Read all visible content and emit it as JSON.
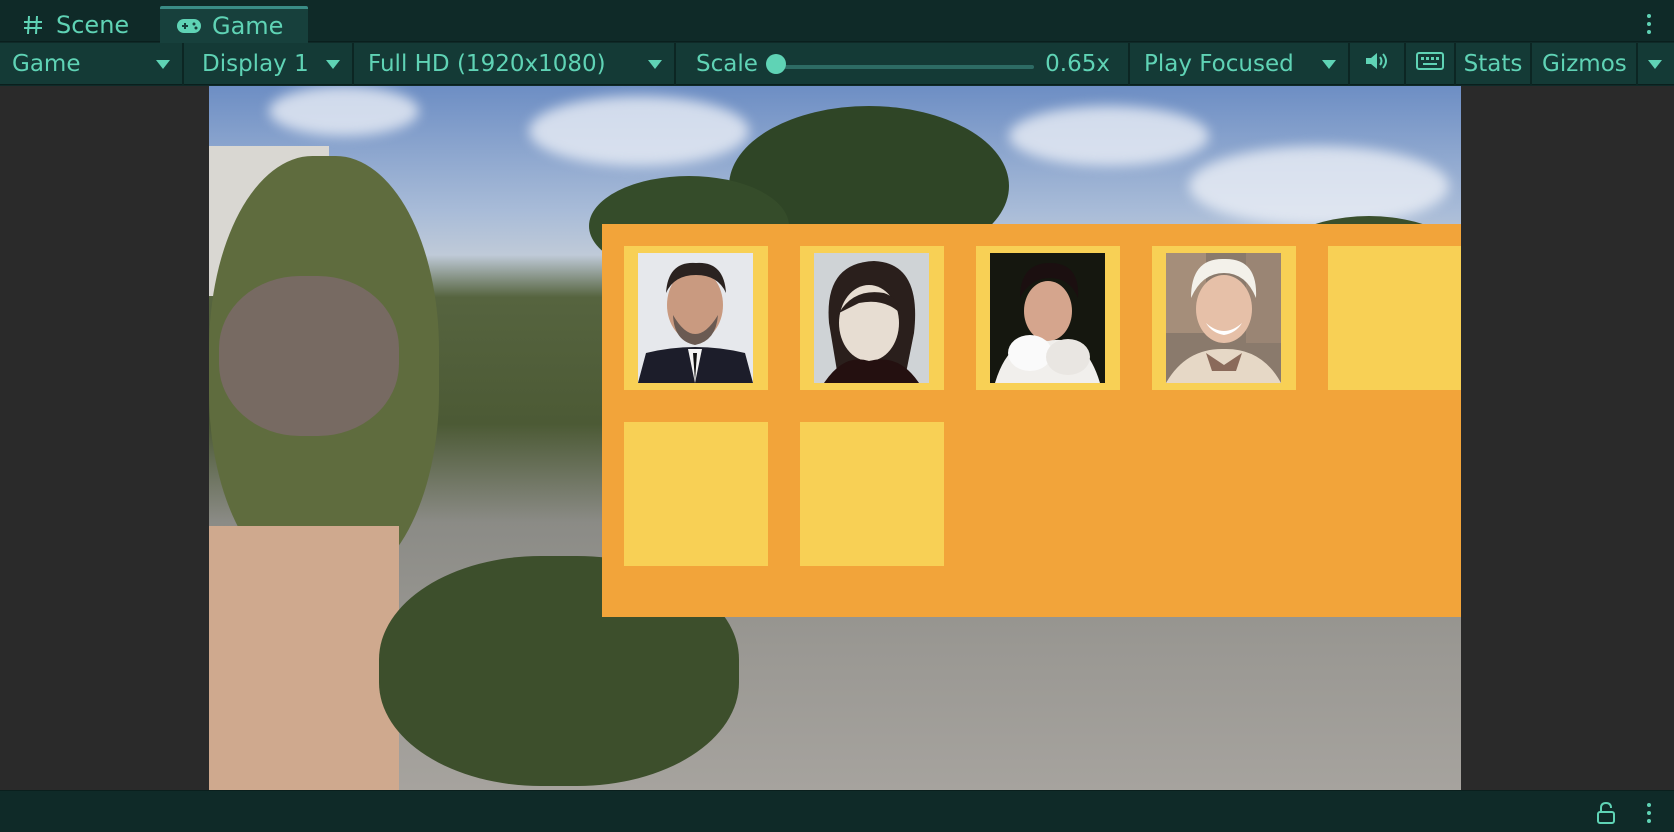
{
  "tabs": {
    "scene_label": "Scene",
    "game_label": "Game"
  },
  "toolbar": {
    "view_mode": "Game",
    "display": "Display 1",
    "resolution": "Full HD (1920x1080)",
    "scale_label": "Scale",
    "scale_value": "0.65x",
    "scale_slider_fraction": 0.0,
    "play_mode": "Play Focused",
    "stats_label": "Stats",
    "gizmos_label": "Gizmos"
  },
  "icons": {
    "scene_tab": "hash-grid-icon",
    "game_tab": "gamepad-icon",
    "audio": "speaker-icon",
    "keyboard": "keyboard-icon",
    "lock": "lock-icon",
    "menu": "kebab-menu-icon"
  },
  "game_view": {
    "grid_slots": [
      {
        "filled": true
      },
      {
        "filled": true
      },
      {
        "filled": true
      },
      {
        "filled": true
      },
      {
        "filled": false
      },
      {
        "filled": false
      },
      {
        "filled": false
      }
    ],
    "colors": {
      "panel": "#f2a43a",
      "slot": "#f8d055"
    }
  },
  "colors": {
    "accent": "#5fd3b5",
    "toolbar_bg": "#143a36",
    "window_bg": "#0f2a28"
  }
}
